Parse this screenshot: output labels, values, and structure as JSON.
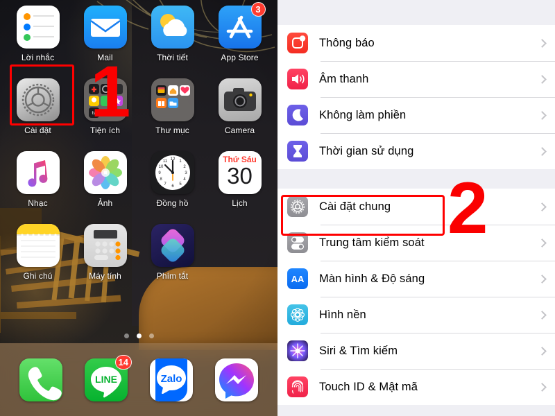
{
  "home": {
    "apps": [
      {
        "label": "Lời nhắc",
        "icon": "reminders-icon",
        "badge": null
      },
      {
        "label": "Mail",
        "icon": "mail-icon",
        "badge": null
      },
      {
        "label": "Thời tiết",
        "icon": "weather-icon",
        "badge": null
      },
      {
        "label": "App Store",
        "icon": "app-store-icon",
        "badge": "3"
      },
      {
        "label": "Cài đặt",
        "icon": "settings-gear-icon",
        "badge": null
      },
      {
        "label": "Tiện ích",
        "icon": "folder-icon",
        "badge": null
      },
      {
        "label": "Thư mục",
        "icon": "folder-icon",
        "badge": null
      },
      {
        "label": "Camera",
        "icon": "camera-icon",
        "badge": null
      },
      {
        "label": "Nhạc",
        "icon": "music-note-icon",
        "badge": null
      },
      {
        "label": "Ảnh",
        "icon": "photos-flower-icon",
        "badge": null
      },
      {
        "label": "Đồng hồ",
        "icon": "clock-icon",
        "badge": null
      },
      {
        "label": "Lịch",
        "icon": "calendar-icon",
        "badge": null
      },
      {
        "label": "Ghi chú",
        "icon": "notes-icon",
        "badge": null
      },
      {
        "label": "Máy tính",
        "icon": "calculator-icon",
        "badge": null
      },
      {
        "label": "Phím tắt",
        "icon": "shortcuts-icon",
        "badge": null
      }
    ],
    "calendar": {
      "weekday": "Thứ Sáu",
      "day": "30"
    },
    "dock": [
      {
        "label": "Phone",
        "icon": "phone-icon",
        "badge": null
      },
      {
        "label": "LINE",
        "icon": "line-icon",
        "badge": "14"
      },
      {
        "label": "Zalo",
        "icon": "zalo-icon",
        "badge": null
      },
      {
        "label": "Messenger",
        "icon": "messenger-icon",
        "badge": null
      }
    ],
    "page_dots": {
      "count": 3,
      "active_index": 1
    }
  },
  "markers": {
    "step_one": "1",
    "step_two": "2"
  },
  "settings": {
    "group_one": [
      {
        "label": "Thông báo",
        "icon": "notifications-icon",
        "color": "#f42d22"
      },
      {
        "label": "Âm thanh",
        "icon": "sound-speaker-icon",
        "color": "#f02249"
      },
      {
        "label": "Không làm phiền",
        "icon": "do-not-disturb-moon-icon",
        "color": "#5b4cd6"
      },
      {
        "label": "Thời gian sử dụng",
        "icon": "screen-time-hourglass-icon",
        "color": "#5b4cd6"
      }
    ],
    "group_two": [
      {
        "label": "Cài đặt chung",
        "icon": "general-gear-icon",
        "color": "#8e8e93",
        "highlighted": true
      },
      {
        "label": "Trung tâm kiểm soát",
        "icon": "control-center-toggles-icon",
        "color": "#8e8e93"
      },
      {
        "label": "Màn hình & Độ sáng",
        "icon": "display-brightness-aa-icon",
        "color": "#0a6bf0",
        "glyph": "AA"
      },
      {
        "label": "Hình nền",
        "icon": "wallpaper-flower-icon",
        "color": "#22abdc"
      },
      {
        "label": "Siri & Tìm kiếm",
        "icon": "siri-orb-icon",
        "color": "#7b5cff"
      },
      {
        "label": "Touch ID & Mật mã",
        "icon": "touch-id-fingerprint-icon",
        "color": "#f02249"
      }
    ]
  }
}
